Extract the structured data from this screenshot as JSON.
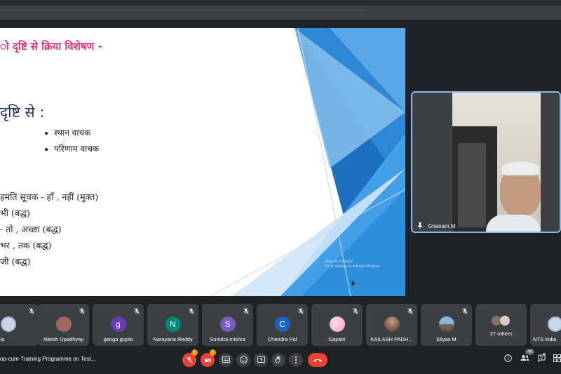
{
  "slide": {
    "title": "ो दृष्टि से क्रिया विशेषण -",
    "heading": "दृष्टि से :",
    "bullets": [
      "स्थान वाचक",
      "परिणाम वाचक"
    ],
    "lines": [
      "हमति सूचक - हाँ , नहीं (मुक्त)",
      "भी (बद्ध)",
      "- तो , अच्छा (बद्ध)",
      "भर , तक (बद्ध)",
      "जी (बद्ध)"
    ],
    "watermark_lines": [
      "Activate Windows",
      "Go to Settings to activate Windows."
    ],
    "accent_colors": [
      "#1565c0",
      "#42a5f5",
      "#90caf9",
      "#e3f2fd"
    ]
  },
  "speaker": {
    "name": "Gnanam M",
    "pin_icon": "pin-icon"
  },
  "participants": [
    {
      "name": "India",
      "avatar_color": "#5f6368",
      "avatar_letter": ""
    },
    {
      "name": "Nitesh Upadhyay",
      "avatar_color": "#8d6e63",
      "avatar_letter": ""
    },
    {
      "name": "ganga gupta",
      "avatar_color": "#673ab7",
      "avatar_letter": "g"
    },
    {
      "name": "Narayana Reddy",
      "avatar_color": "#00897b",
      "avatar_letter": "N"
    },
    {
      "name": "Sumitra mishra",
      "avatar_color": "#7e57c2",
      "avatar_letter": "S"
    },
    {
      "name": "Chandra Pal",
      "avatar_color": "#1565c0",
      "avatar_letter": "C"
    },
    {
      "name": "Gayatri",
      "avatar_color": "#f8bbd0",
      "avatar_letter": ""
    },
    {
      "name": "KAILASH PADH...",
      "avatar_color": "#6d4c41",
      "avatar_letter": ""
    },
    {
      "name": "Eliyas M",
      "avatar_color": "#546e7a",
      "avatar_letter": ""
    },
    {
      "name": "27 others",
      "avatar_color": "#8d6e63",
      "avatar_letter": ""
    },
    {
      "name": "NTS India",
      "avatar_color": "#5f6368",
      "avatar_letter": ""
    }
  ],
  "toolbar": {
    "meeting_title": "op-cum-Training Programme on Test...",
    "badge_mic": "!",
    "badge_cam": "!",
    "end_call_icon": "phone-hangup-icon",
    "people_count": "40"
  }
}
